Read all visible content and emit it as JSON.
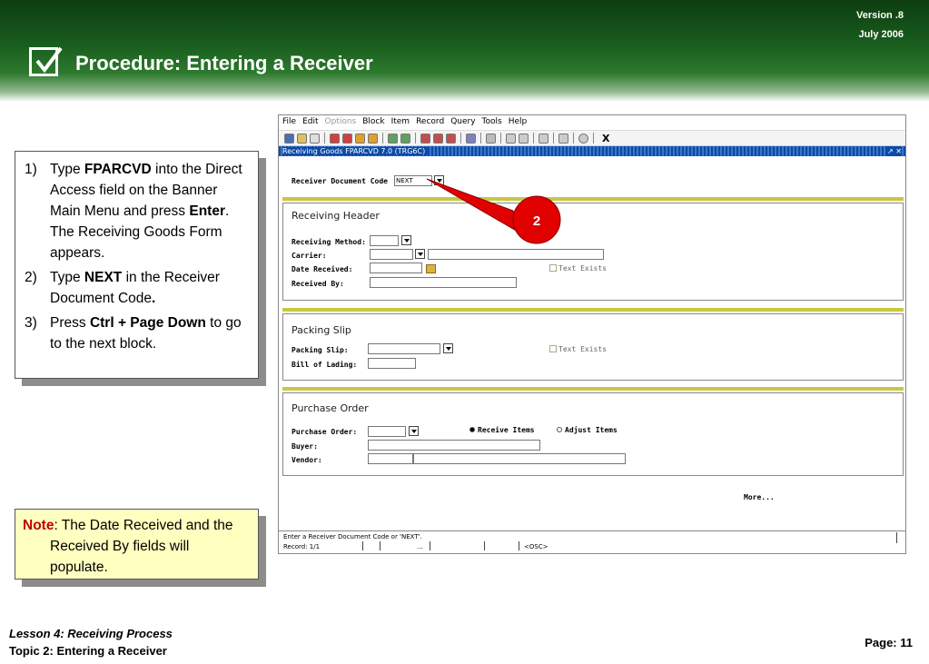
{
  "header": {
    "title": "Procedure: Entering a Receiver",
    "version": "Version .8",
    "date": "July  2006"
  },
  "steps": [
    {
      "num": "1)",
      "parts": [
        "Type ",
        "FPARCVD",
        " into the Direct Access field on the Banner Main Menu and press ",
        "Enter",
        ". The Receiving Goods Form appears."
      ]
    },
    {
      "num": "2)",
      "parts": [
        "Type ",
        "NEXT",
        " in the Receiver Document Code",
        ".",
        ""
      ]
    },
    {
      "num": "3)",
      "parts": [
        "Press ",
        "Ctrl + Page Down",
        " to go to the next block.",
        "",
        ""
      ]
    }
  ],
  "note": {
    "label": "Note",
    "text_line1": ": The Date Received and the",
    "text_line2": "Received By fields will",
    "text_line3": "populate."
  },
  "footer": {
    "lesson": "Lesson 4: Receiving Process",
    "topic": "Topic 2: Entering a Receiver",
    "page": "Page: 11"
  },
  "callout": {
    "label": "2",
    "color": "#e00000"
  },
  "app": {
    "menu": [
      "File",
      "Edit",
      "Options",
      "Block",
      "Item",
      "Record",
      "Query",
      "Tools",
      "Help"
    ],
    "menu_disabled": [
      "Options"
    ],
    "toolbar_close": "X",
    "window_title": "Receiving Goods  FPARCVD  7.0  (TRG6C)",
    "window_controls": "↗ ✕",
    "receiver_label": "Receiver Document Code",
    "receiver_value": "NEXT",
    "receiving_header": {
      "title": "Receiving Header",
      "method_label": "Receiving Method:",
      "carrier_label": "Carrier:",
      "date_label": "Date Received:",
      "by_label": "Received By:",
      "text_exists": "Text Exists"
    },
    "packing_slip": {
      "title": "Packing Slip",
      "slip_label": "Packing Slip:",
      "lading_label": "Bill of Lading:",
      "text_exists": "Text Exists"
    },
    "purchase_order": {
      "title": "Purchase Order",
      "po_label": "Purchase Order:",
      "buyer_label": "Buyer:",
      "vendor_label": "Vendor:",
      "receive_items": "Receive Items",
      "adjust_items": "Adjust Items"
    },
    "more": "More...",
    "status_message": "Enter a Receiver Document Code or 'NEXT'.",
    "record": "Record: 1/1",
    "ellipsis": "...",
    "osc": "<OSC>"
  }
}
